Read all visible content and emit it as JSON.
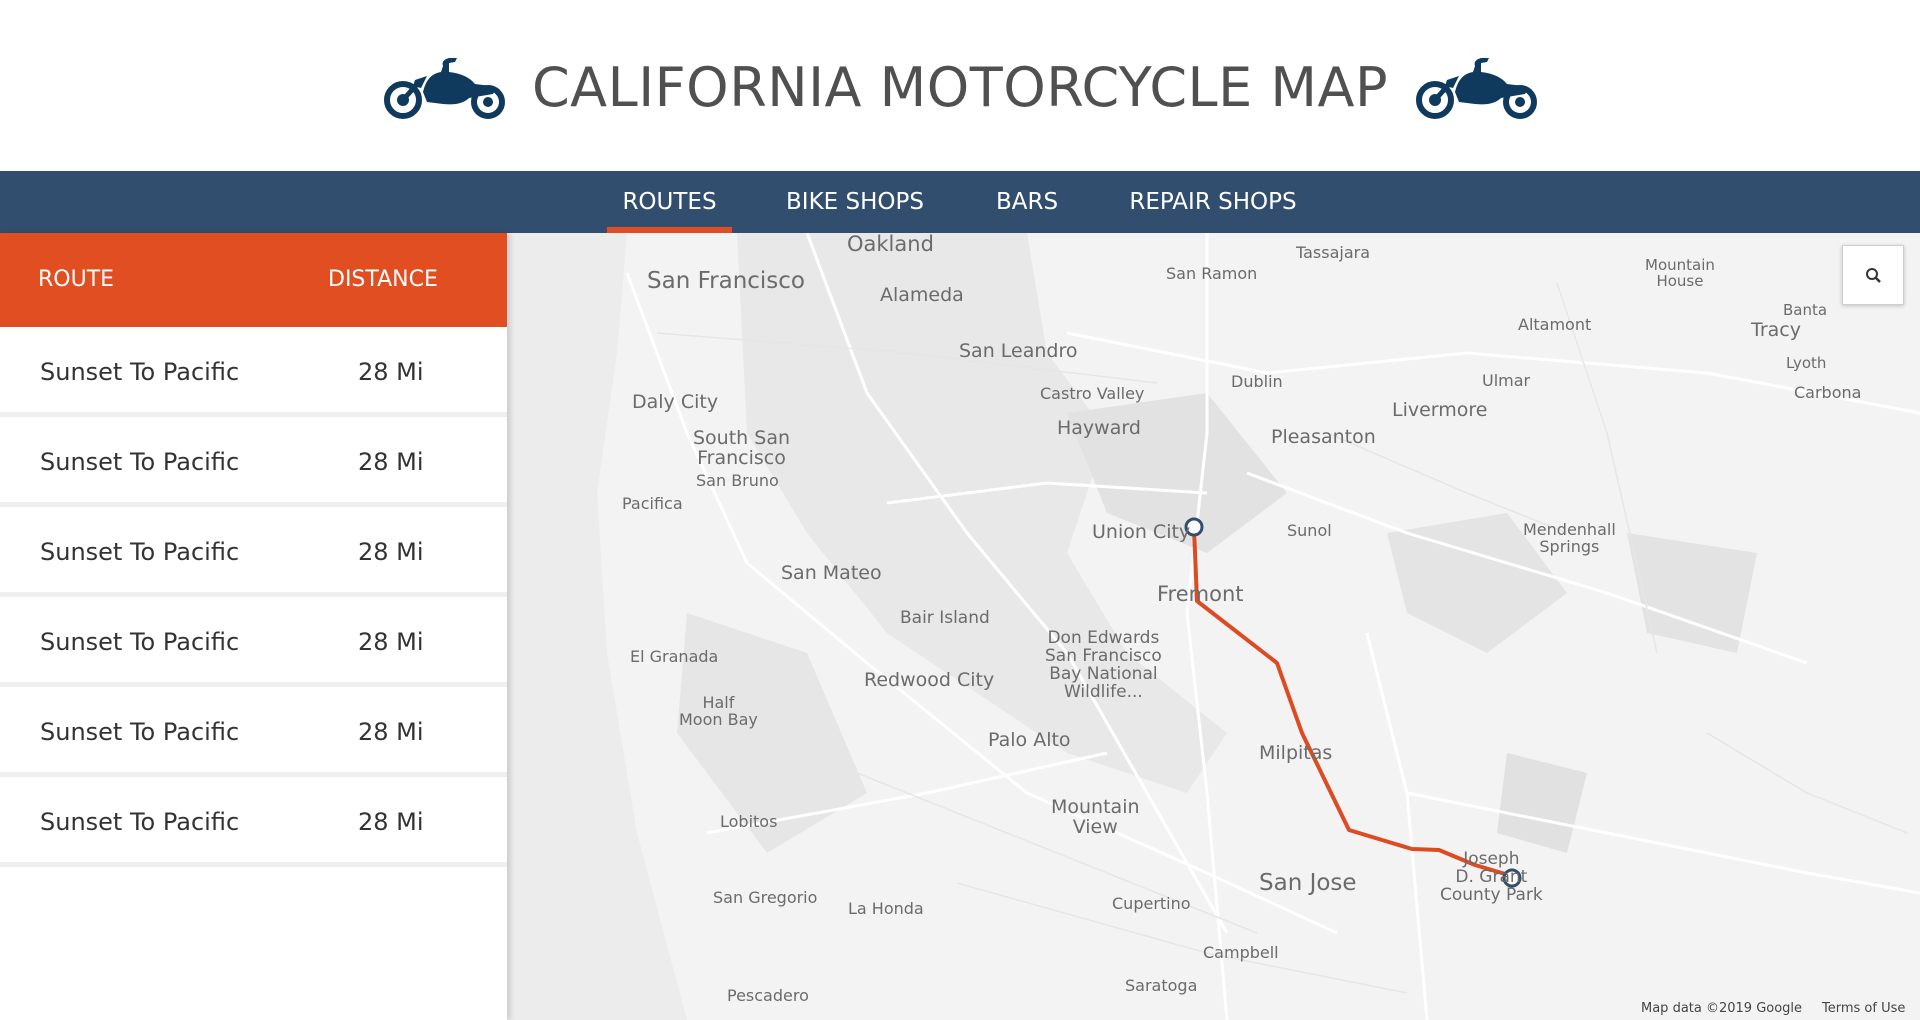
{
  "header": {
    "title": "CALIFORNIA MOTORCYCLE MAP"
  },
  "nav": {
    "items": [
      {
        "label": "ROUTES",
        "active": true
      },
      {
        "label": "BIKE SHOPS",
        "active": false
      },
      {
        "label": "BARS",
        "active": false
      },
      {
        "label": "REPAIR SHOPS",
        "active": false
      }
    ]
  },
  "sidebar": {
    "columns": {
      "route": "ROUTE",
      "distance": "DISTANCE"
    },
    "routes": [
      {
        "name": "Sunset To Pacific",
        "distance": "28 Mi"
      },
      {
        "name": "Sunset To Pacific",
        "distance": "28 Mi"
      },
      {
        "name": "Sunset To Pacific",
        "distance": "28 Mi"
      },
      {
        "name": "Sunset To Pacific",
        "distance": "28 Mi"
      },
      {
        "name": "Sunset To Pacific",
        "distance": "28 Mi"
      },
      {
        "name": "Sunset To Pacific",
        "distance": "28 Mi"
      }
    ]
  },
  "map": {
    "places": [
      "Oakland",
      "San Francisco",
      "Alameda",
      "San Leandro",
      "Daly City",
      "South San\nFrancisco",
      "San Bruno",
      "Pacifica",
      "San Mateo",
      "Bair Island",
      "El Granada",
      "Half\nMoon Bay",
      "Redwood City",
      "Don Edwards\nSan Francisco\nBay National\nWildlife...",
      "Palo Alto",
      "Mountain\nView",
      "Lobitos",
      "San Gregorio",
      "La Honda",
      "Pescadero",
      "Cupertino",
      "Campbell",
      "Saratoga",
      "San Jose",
      "Milpitas",
      "Fremont",
      "Union City",
      "Hayward",
      "Castro Valley",
      "San Ramon",
      "Dublin",
      "Pleasanton",
      "Livermore",
      "Sunol",
      "Tassajara",
      "Altamont",
      "Ulmar",
      "Mountain\nHouse",
      "Tracy",
      "Banta",
      "Lyoth",
      "Carbona",
      "Mendenhall\nSprings",
      "Joseph\nD. Grant\nCounty Park"
    ],
    "search_icon": "search-icon",
    "attribution": "Map data ©2019 Google",
    "terms_link": "Terms of Use"
  },
  "colors": {
    "nav_bg": "#324e6f",
    "accent": "#e04e22",
    "route_line": "#dd4b22",
    "icon": "#0f3a5e"
  }
}
